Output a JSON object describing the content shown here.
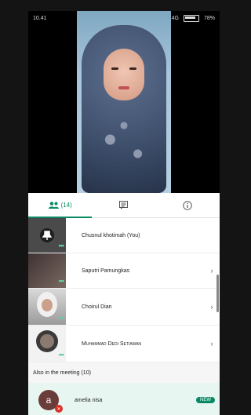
{
  "status": {
    "time": "10.41",
    "network": "4G",
    "battery": "78%"
  },
  "tabs": [
    {
      "icon": "people-icon",
      "label": "(14)"
    },
    {
      "icon": "chat-icon",
      "label": ""
    },
    {
      "icon": "info-icon",
      "label": ""
    }
  ],
  "participants": [
    {
      "name": "Chusnul khotimah (You)"
    },
    {
      "name": "Saputri Pamungkas"
    },
    {
      "name": "Choirul Dian"
    },
    {
      "name": "Muhammad Dedi Setiawan"
    }
  ],
  "also_in_meeting": {
    "label": "Also in the meeting (10)"
  },
  "attendee": {
    "initial": "a",
    "name": "amelia nisa",
    "badge": "NEW"
  },
  "accent_color": "#0a8a64"
}
